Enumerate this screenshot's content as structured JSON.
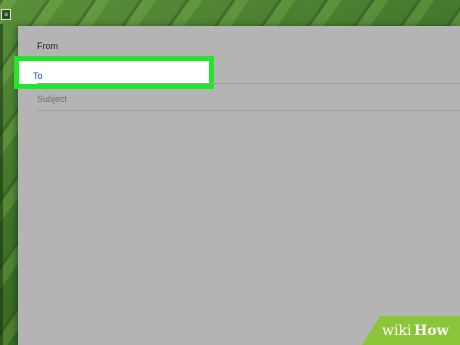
{
  "desktop": {
    "window_icon_glyph": "≡"
  },
  "compose": {
    "from_label": "From",
    "to_label": "To",
    "subject_label": "Subject",
    "highlight_color": "#22e52e"
  },
  "watermark": {
    "part1": "wiki",
    "part2": "How"
  },
  "colors": {
    "window_background": "#b4b4b4",
    "to_text": "#2456a8",
    "wallpaper": "#3f6b2a"
  }
}
